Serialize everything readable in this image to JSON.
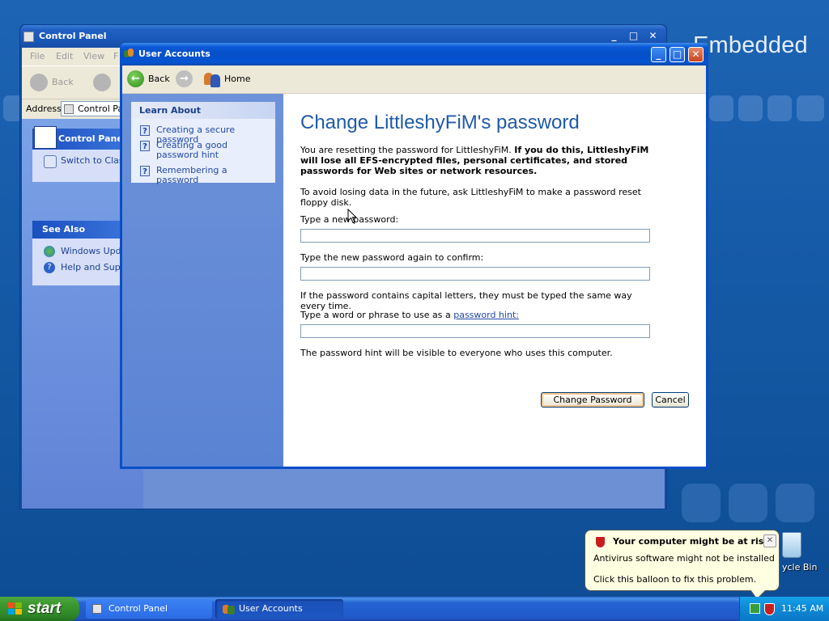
{
  "desktop": {
    "branding": "Embedded",
    "recycle_bin_label": "ycle Bin"
  },
  "control_panel": {
    "title": "Control Panel",
    "menu": [
      "File",
      "Edit",
      "View",
      "F"
    ],
    "back_label": "Back",
    "address_label": "Address",
    "address_value": "Control Pa",
    "task_box_title": "Control Panel",
    "switch_label": "Switch to Class",
    "see_also_title": "See Also",
    "see_also_items": [
      "Windows Updat",
      "Help and Suppo"
    ]
  },
  "user_accounts": {
    "title": "User Accounts",
    "toolbar": {
      "back_label": "Back",
      "home_label": "Home"
    },
    "learn_about": {
      "title": "Learn About",
      "items": [
        "Creating a secure password",
        "Creating a good password hint",
        "Remembering a password"
      ]
    },
    "heading": "Change LittleshyFiM's password",
    "warning_normal": "You are resetting the password for LittleshyFiM. ",
    "warning_bold": "If you do this, LittleshyFiM will lose all EFS-encrypted files, personal certificates, and stored passwords for Web sites or network resources.",
    "avoid_text": "To avoid losing data in the future, ask LittleshyFiM to make a password reset floppy disk.",
    "new_password_label": "Type a new password:",
    "new_password_value": "",
    "confirm_label": "Type the new password again to confirm:",
    "confirm_value": "",
    "capital_note": "If the password contains capital letters, they must be typed the same way every time.",
    "hint_label_prefix": "Type a word or phrase to use as a ",
    "hint_link": "password hint:",
    "hint_value": "",
    "hint_note": "The password hint will be visible to everyone who uses this computer.",
    "change_button": "Change Password",
    "cancel_button": "Cancel"
  },
  "balloon": {
    "title": "Your computer might be at risk",
    "line1": "Antivirus software might not be installed",
    "line2": "Click this balloon to fix this problem."
  },
  "taskbar": {
    "start_label": "start",
    "items": [
      "Control Panel",
      "User Accounts"
    ],
    "clock": "11:45 AM"
  }
}
